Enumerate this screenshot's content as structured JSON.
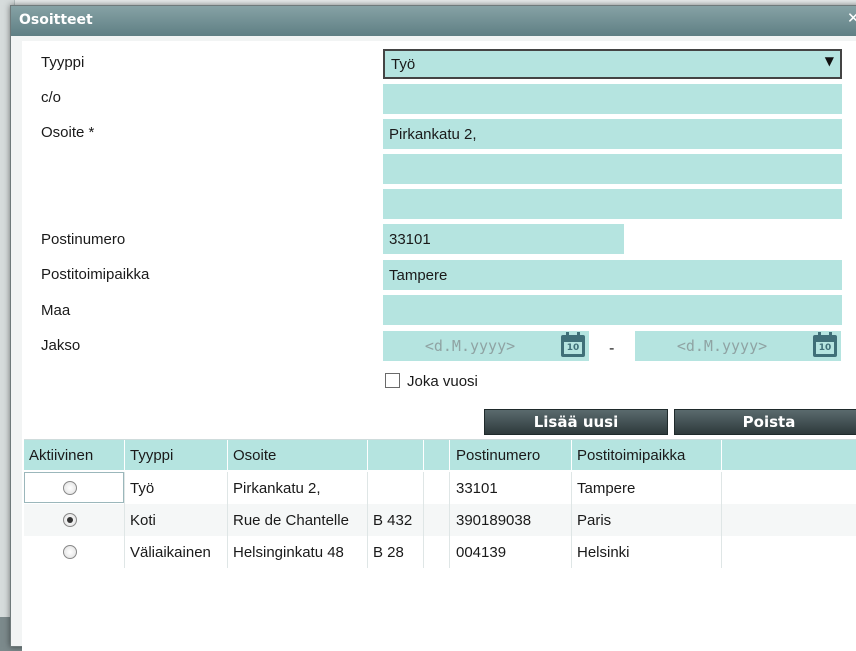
{
  "dialog": {
    "title": "Osoitteet"
  },
  "form": {
    "labels": {
      "type": "Tyyppi",
      "co": "c/o",
      "address": "Osoite *",
      "postal_code": "Postinumero",
      "city": "Postitoimipaikka",
      "country": "Maa",
      "period": "Jakso"
    },
    "type_value": "Työ",
    "co_value": "",
    "address_line1": "Pirkankatu 2,",
    "address_line2": "",
    "address_line3": "",
    "postal_code_value": "33101",
    "city_value": "Tampere",
    "country_value": "",
    "period_start_placeholder": "<d.M.yyyy>",
    "period_end_placeholder": "<d.M.yyyy>",
    "period_separator": "-",
    "yearly_label": "Joka vuosi",
    "yearly_checked": false
  },
  "buttons": {
    "add_new": "Lisää uusi",
    "delete": "Poista"
  },
  "table": {
    "headers": [
      "Aktiivinen",
      "Tyyppi",
      "Osoite",
      "",
      "",
      "Postinumero",
      "Postitoimipaikka"
    ],
    "rows": [
      {
        "active": false,
        "type": "Työ",
        "address": "Pirkankatu 2,",
        "extra": "",
        "postal_code": "33101",
        "city": "Tampere"
      },
      {
        "active": true,
        "type": "Koti",
        "address": "Rue de Chantelle",
        "extra": "B 432",
        "postal_code": "390189038",
        "city": "Paris"
      },
      {
        "active": false,
        "type": "Väliaikainen",
        "address": "Helsinginkatu 48",
        "extra": "B 28",
        "postal_code": "004139",
        "city": "Helsinki"
      }
    ]
  },
  "colors": {
    "field_bg": "#b5e4e0",
    "button_bg": "#2e3a3c",
    "title_bg": "#5f7f84"
  }
}
